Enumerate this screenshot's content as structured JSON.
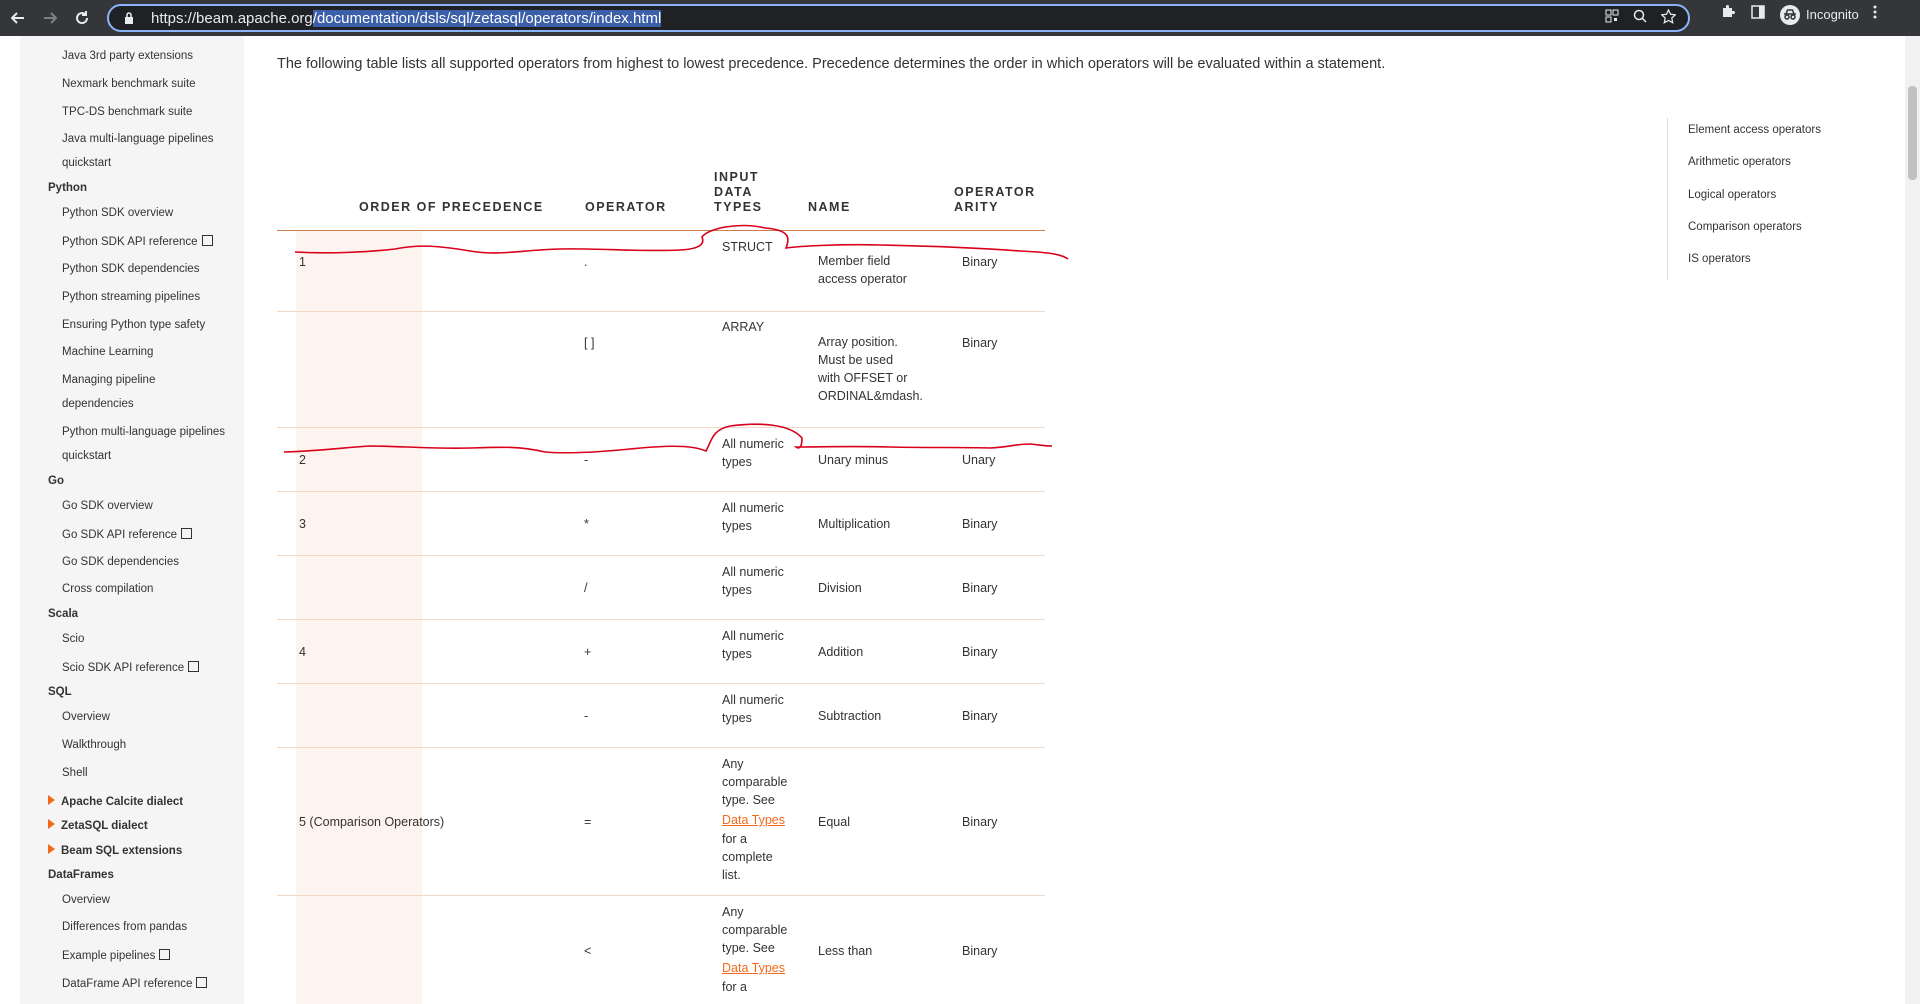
{
  "browser": {
    "url_prefix": "https://beam.apache.org",
    "url_selected": "/documentation/dsls/sql/zetasql/operators/index.html",
    "profile_label": "Incognito"
  },
  "sidebar": {
    "items": [
      {
        "label": "Java 3rd party extensions",
        "type": "sub"
      },
      {
        "label": "Nexmark benchmark suite",
        "type": "sub"
      },
      {
        "label": "TPC-DS benchmark suite",
        "type": "sub"
      },
      {
        "label": "Java multi-language pipelines",
        "type": "sub"
      },
      {
        "label": "quickstart",
        "type": "sub"
      },
      {
        "label": "Python",
        "type": "head"
      },
      {
        "label": "Python SDK overview",
        "type": "sub"
      },
      {
        "label": "Python SDK API reference",
        "type": "sub",
        "external": true
      },
      {
        "label": "Python SDK dependencies",
        "type": "sub"
      },
      {
        "label": "Python streaming pipelines",
        "type": "sub"
      },
      {
        "label": "Ensuring Python type safety",
        "type": "sub"
      },
      {
        "label": "Machine Learning",
        "type": "sub"
      },
      {
        "label": "Managing pipeline",
        "type": "sub"
      },
      {
        "label": "dependencies",
        "type": "sub"
      },
      {
        "label": "Python multi-language pipelines",
        "type": "sub"
      },
      {
        "label": "quickstart",
        "type": "sub"
      },
      {
        "label": "Go",
        "type": "head"
      },
      {
        "label": "Go SDK overview",
        "type": "sub"
      },
      {
        "label": "Go SDK API reference",
        "type": "sub",
        "external": true
      },
      {
        "label": "Go SDK dependencies",
        "type": "sub"
      },
      {
        "label": "Cross compilation",
        "type": "sub"
      },
      {
        "label": "Scala",
        "type": "head"
      },
      {
        "label": "Scio",
        "type": "sub"
      },
      {
        "label": "Scio SDK API reference",
        "type": "sub",
        "external": true
      },
      {
        "label": "SQL",
        "type": "head"
      },
      {
        "label": "Overview",
        "type": "sub"
      },
      {
        "label": "Walkthrough",
        "type": "sub"
      },
      {
        "label": "Shell",
        "type": "sub"
      },
      {
        "label": "Apache Calcite dialect",
        "type": "collapsed"
      },
      {
        "label": "ZetaSQL dialect",
        "type": "collapsed"
      },
      {
        "label": "Beam SQL extensions",
        "type": "collapsed"
      },
      {
        "label": "DataFrames",
        "type": "head"
      },
      {
        "label": "Overview",
        "type": "sub"
      },
      {
        "label": "Differences from pandas",
        "type": "sub"
      },
      {
        "label": "Example pipelines",
        "type": "sub",
        "external": true
      },
      {
        "label": "DataFrame API reference",
        "type": "sub",
        "external": true
      }
    ]
  },
  "content": {
    "intro": "The following table lists all supported operators from highest to lowest precedence. Precedence determines the order in which operators will be evaluated within a statement.",
    "headers": {
      "order": "ORDER OF PRECEDENCE",
      "operator": "OPERATOR",
      "input_1": "INPUT",
      "input_2": "DATA",
      "input_3": "TYPES",
      "name": "NAME",
      "arity_1": "OPERATOR",
      "arity_2": "ARITY"
    },
    "rows": [
      {
        "order": "1",
        "operator": ".",
        "types": [
          "STRUCT"
        ],
        "name": [
          "Member field",
          "access operator"
        ],
        "arity": "Binary"
      },
      {
        "order": "",
        "operator": "[ ]",
        "types": [
          "ARRAY"
        ],
        "name": [
          "Array position.",
          "Must be used",
          "with OFFSET or",
          "ORDINAL&mdash."
        ],
        "arity": "Binary"
      },
      {
        "order": "2",
        "operator": "-",
        "types": [
          "All numeric",
          "types"
        ],
        "name": [
          "Unary minus"
        ],
        "arity": "Unary"
      },
      {
        "order": "3",
        "operator": "*",
        "types": [
          "All numeric",
          "types"
        ],
        "name": [
          "Multiplication"
        ],
        "arity": "Binary"
      },
      {
        "order": "",
        "operator": "/",
        "types": [
          "All numeric",
          "types"
        ],
        "name": [
          "Division"
        ],
        "arity": "Binary"
      },
      {
        "order": "4",
        "operator": "+",
        "types": [
          "All numeric",
          "types"
        ],
        "name": [
          "Addition"
        ],
        "arity": "Binary"
      },
      {
        "order": "",
        "operator": "-",
        "types": [
          "All numeric",
          "types"
        ],
        "name": [
          "Subtraction"
        ],
        "arity": "Binary"
      },
      {
        "order": "5 (Comparison Operators)",
        "operator": "=",
        "types": [
          "Any",
          "comparable",
          "type. See"
        ],
        "link": "Data Types",
        "types_after": [
          "for a",
          "complete",
          "list."
        ],
        "name": [
          "Equal"
        ],
        "arity": "Binary"
      },
      {
        "order": "",
        "operator": "<",
        "types": [
          "Any",
          "comparable",
          "type. See"
        ],
        "link": "Data Types",
        "types_after": [
          "for a"
        ],
        "name": [
          "Less than"
        ],
        "arity": "Binary"
      }
    ]
  },
  "toc": {
    "items": [
      "Element access operators",
      "Arithmetic operators",
      "Logical operators",
      "Comparison operators",
      "IS operators"
    ]
  },
  "colors": {
    "accent": "#f26b1d",
    "annotation": "#d9001b",
    "operator_column_bg": "#fdf4ef"
  }
}
